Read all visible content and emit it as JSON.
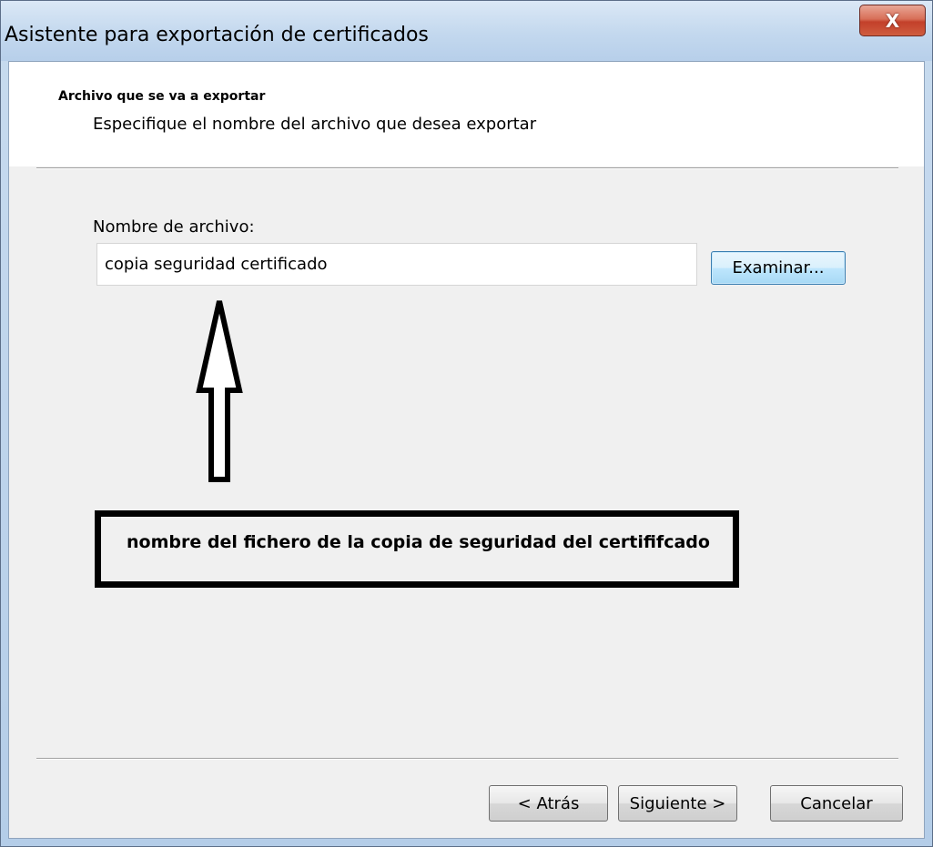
{
  "window": {
    "title": "Asistente para exportación de certificados",
    "close_label": "X"
  },
  "header": {
    "title": "Archivo que se va a exportar",
    "subtitle": "Especifique el nombre del archivo que desea exportar"
  },
  "form": {
    "filename_label": "Nombre de archivo:",
    "filename_value": "copia seguridad certificado",
    "browse_label": "Examinar..."
  },
  "annotation": {
    "text": "nombre del fichero de la copia de seguridad del certififcado",
    "arrow_icon": "up-arrow-icon"
  },
  "footer": {
    "back_label": "< Atrás",
    "next_label": "Siguiente >",
    "cancel_label": "Cancelar"
  },
  "colors": {
    "close_button": "#c3402a",
    "focused_button_border": "#3c7fb1",
    "dialog_background": "#f0f0f0",
    "header_background": "#ffffff"
  }
}
